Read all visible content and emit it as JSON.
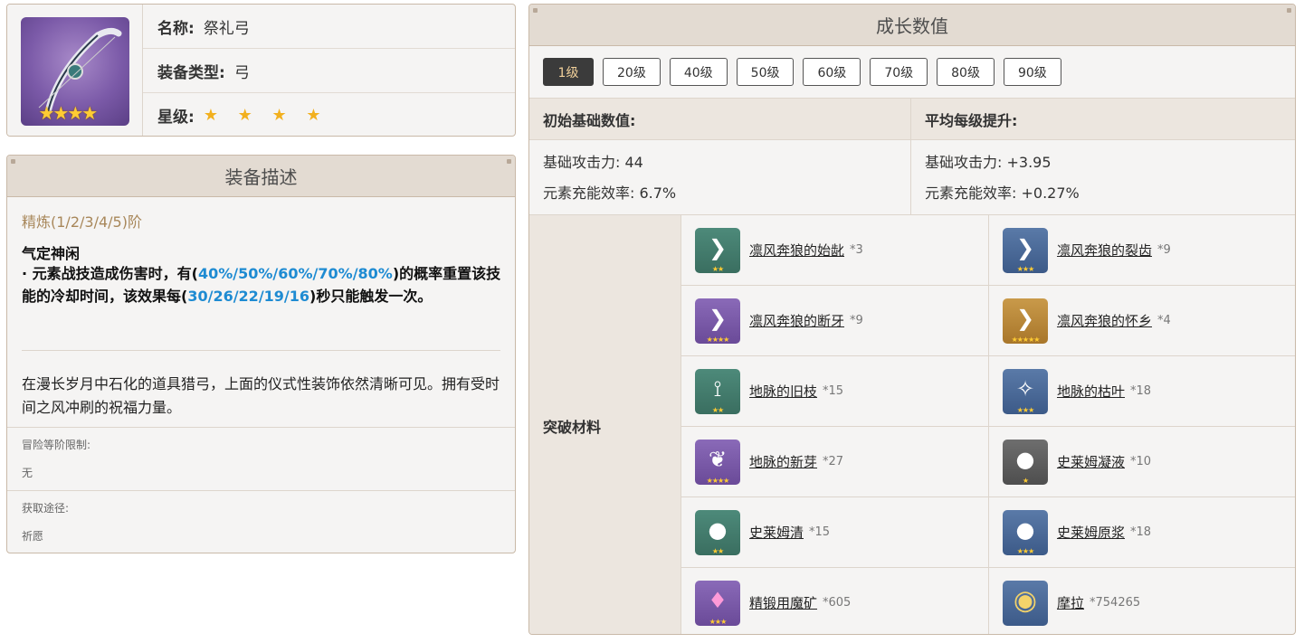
{
  "weapon": {
    "name_label": "名称:",
    "name": "祭礼弓",
    "type_label": "装备类型:",
    "type": "弓",
    "rarity_label": "星级:",
    "rarity_stars": "★ ★ ★ ★",
    "icon_stars": "★★★★"
  },
  "description": {
    "title": "装备描述",
    "refine": "精炼(1/2/3/4/5)阶",
    "passive_name": "气定神闲",
    "passive_p1": "· 元素战技造成伤害时，有(",
    "passive_h1": "40%/50%/60%/70%/80%",
    "passive_p2": ")的概率重置该技能的冷却时间，该效果每(",
    "passive_h2": "30/26/22/19/16",
    "passive_p3": ")秒只能触发一次。",
    "lore": "在漫长岁月中石化的道具猎弓，上面的仪式性装饰依然清晰可见。拥有受时间之风冲刷的祝福力量。",
    "limit_label": "冒险等阶限制:",
    "limit_value": "无",
    "source_label": "获取途径:",
    "source_value": "祈愿"
  },
  "growth": {
    "title": "成长数值",
    "levels": [
      "1级",
      "20级",
      "40级",
      "50级",
      "60级",
      "70级",
      "80级",
      "90级"
    ],
    "active_level": "1级",
    "base_header": "初始基础数值:",
    "avg_header": "平均每级提升:",
    "base_atk": "基础攻击力: 44",
    "base_er": "元素充能效率: 6.7%",
    "avg_atk": "基础攻击力: +3.95",
    "avg_er": "元素充能效率: +0.27%",
    "materials_label": "突破材料",
    "materials": [
      {
        "name": "凛风奔狼的始龀",
        "count": "*3",
        "stars": "★★",
        "color": "bg2",
        "icon": "tooth-icon"
      },
      {
        "name": "凛风奔狼的裂齿",
        "count": "*9",
        "stars": "★★★",
        "color": "bg3",
        "icon": "tooth-icon"
      },
      {
        "name": "凛风奔狼的断牙",
        "count": "*9",
        "stars": "★★★★",
        "color": "bg4",
        "icon": "tooth-icon"
      },
      {
        "name": "凛风奔狼的怀乡",
        "count": "*4",
        "stars": "★★★★★",
        "color": "bg5",
        "icon": "tooth-icon"
      },
      {
        "name": "地脉的旧枝",
        "count": "*15",
        "stars": "★★",
        "color": "bg2",
        "icon": "branch-icon"
      },
      {
        "name": "地脉的枯叶",
        "count": "*18",
        "stars": "★★★",
        "color": "bg3",
        "icon": "leaf-icon"
      },
      {
        "name": "地脉的新芽",
        "count": "*27",
        "stars": "★★★★",
        "color": "bg4",
        "icon": "sprout-icon"
      },
      {
        "name": "史莱姆凝液",
        "count": "*10",
        "stars": "★",
        "color": "bg1",
        "icon": "slime-icon"
      },
      {
        "name": "史莱姆清",
        "count": "*15",
        "stars": "★★",
        "color": "bg2",
        "icon": "slime-icon"
      },
      {
        "name": "史莱姆原浆",
        "count": "*18",
        "stars": "★★★",
        "color": "bg3",
        "icon": "slime-icon"
      },
      {
        "name": "精锻用魔矿",
        "count": "*605",
        "stars": "★★★",
        "color": "bg4",
        "icon": "ore-icon"
      },
      {
        "name": "摩拉",
        "count": "*754265",
        "stars": "",
        "color": "bg3",
        "icon": "mora-icon"
      }
    ]
  }
}
